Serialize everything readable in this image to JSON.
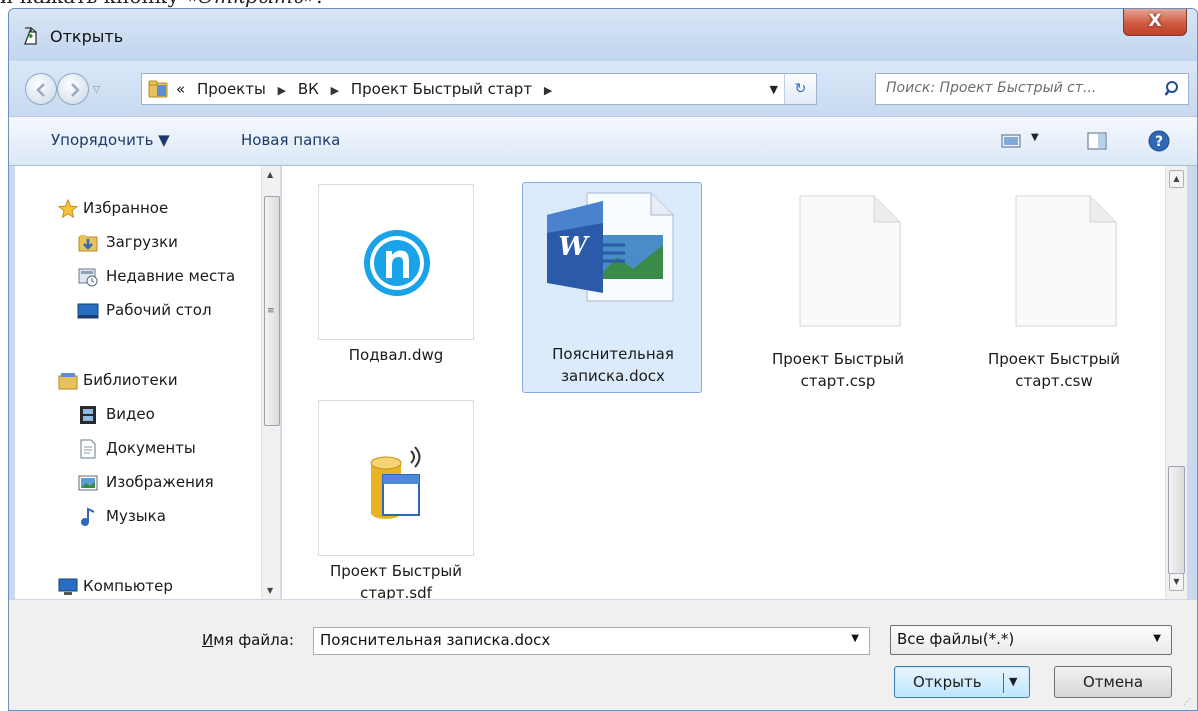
{
  "doc_fragment": {
    "prefix": "и нажать кнопку ",
    "emphasis": "«Открыть»."
  },
  "window": {
    "title": "Открыть",
    "close_label": "X"
  },
  "address": {
    "overflow": "«",
    "crumbs": [
      "Проекты",
      "ВК",
      "Проект Быстрый старт"
    ],
    "separator": "▶"
  },
  "search": {
    "placeholder": "Поиск: Проект Быстрый ст..."
  },
  "toolbar": {
    "organize": "Упорядочить ▼",
    "new_folder": "Новая папка"
  },
  "sidebar": {
    "items": [
      {
        "label": "Избранное",
        "icon": "star-icon"
      },
      {
        "label": "Загрузки",
        "icon": "downloads-folder-icon"
      },
      {
        "label": "Недавние места",
        "icon": "recent-places-icon"
      },
      {
        "label": "Рабочий стол",
        "icon": "desktop-icon"
      },
      {
        "label": "Библиотеки",
        "icon": "libraries-icon"
      },
      {
        "label": "Видео",
        "icon": "video-icon"
      },
      {
        "label": "Документы",
        "icon": "documents-icon"
      },
      {
        "label": "Изображения",
        "icon": "pictures-icon"
      },
      {
        "label": "Музыка",
        "icon": "music-icon"
      },
      {
        "label": "Компьютер",
        "icon": "computer-icon"
      }
    ]
  },
  "files": [
    {
      "name_line1": "Подвал.dwg",
      "name_line2": "",
      "icon": "nanocad-icon",
      "selected": false
    },
    {
      "name_line1": "Пояснительная",
      "name_line2": "записка.docx",
      "icon": "word-document-icon",
      "selected": true
    },
    {
      "name_line1": "Проект Быстрый",
      "name_line2": "старт.csp",
      "icon": "blank-file-icon",
      "selected": false
    },
    {
      "name_line1": "Проект Быстрый",
      "name_line2": "старт.csw",
      "icon": "blank-file-icon",
      "selected": false
    },
    {
      "name_line1": "Проект Быстрый",
      "name_line2": "старт.sdf",
      "icon": "database-file-icon",
      "selected": false
    }
  ],
  "footer": {
    "filename_label_underlined": "И",
    "filename_label_rest": "мя файла:",
    "filename_value": "Пояснительная записка.docx",
    "filetype_value": "Все файлы(*.*)",
    "open_label": "Открыть",
    "cancel_label": "Отмена"
  }
}
